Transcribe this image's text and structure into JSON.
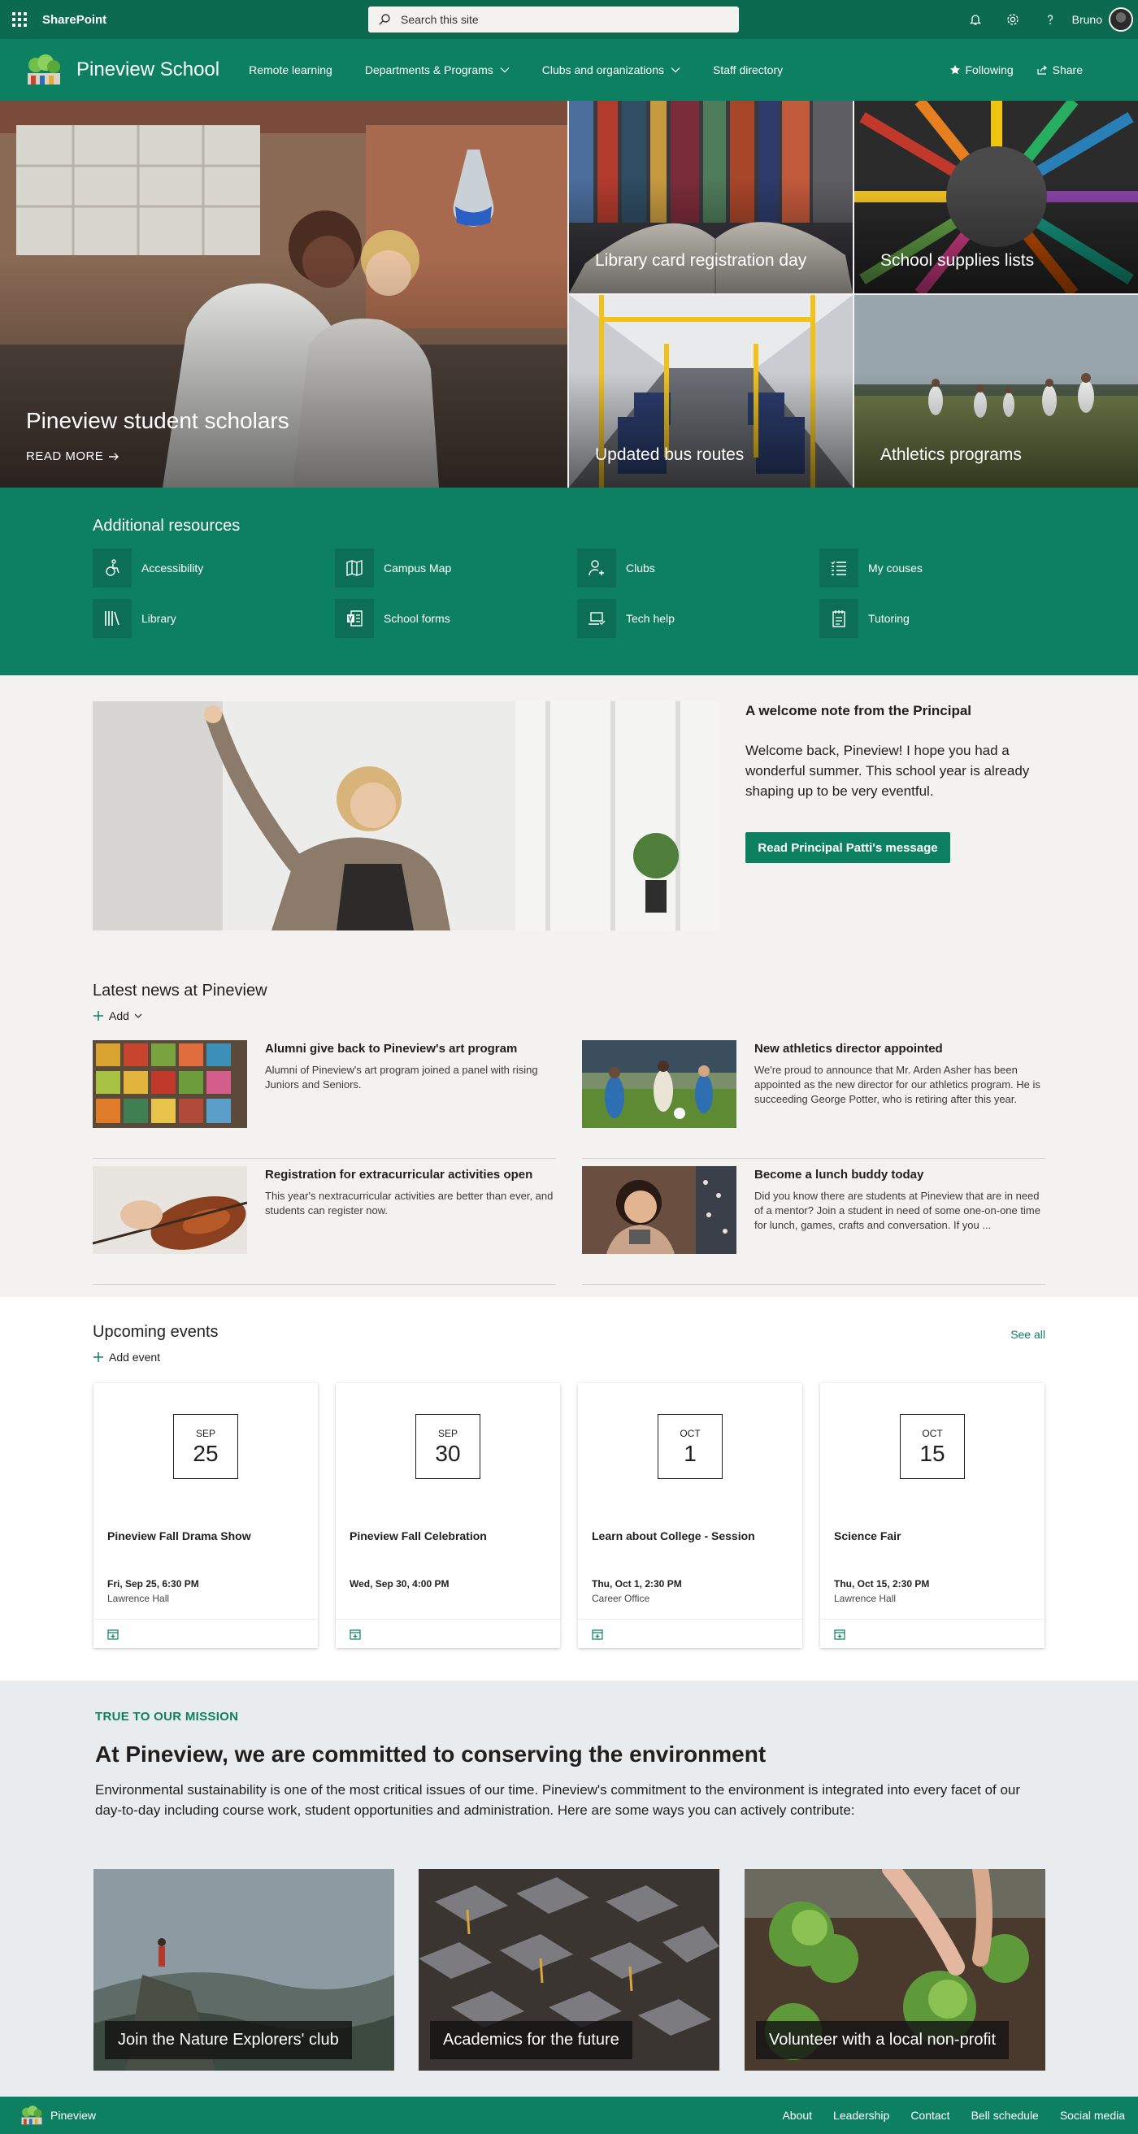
{
  "suite": {
    "app_name": "SharePoint",
    "search_placeholder": "Search this site",
    "user_name": "Bruno"
  },
  "site": {
    "title": "Pineview School",
    "nav": [
      {
        "label": "Remote learning",
        "has_dropdown": false
      },
      {
        "label": "Departments & Programs",
        "has_dropdown": true
      },
      {
        "label": "Clubs and organizations",
        "has_dropdown": true
      },
      {
        "label": "Staff directory",
        "has_dropdown": false
      }
    ],
    "following_label": "Following",
    "share_label": "Share"
  },
  "hero": {
    "main_caption": "Pineview student scholars",
    "read_more": "READ MORE",
    "tiles": [
      "Library card registration day",
      "School supplies lists",
      "Updated bus routes",
      "Athletics programs"
    ]
  },
  "resources": {
    "title": "Additional resources",
    "items": [
      {
        "label": "Accessibility",
        "icon": "accessibility-icon"
      },
      {
        "label": "Campus Map",
        "icon": "map-icon"
      },
      {
        "label": "Clubs",
        "icon": "person-add-icon"
      },
      {
        "label": "My couses",
        "icon": "list-icon"
      },
      {
        "label": "Library",
        "icon": "library-icon"
      },
      {
        "label": "School forms",
        "icon": "forms-icon"
      },
      {
        "label": "Tech help",
        "icon": "laptop-icon"
      },
      {
        "label": "Tutoring",
        "icon": "notepad-icon"
      }
    ]
  },
  "welcome": {
    "title": "A welcome note from the Principal",
    "body": "Welcome back, Pineview! I hope you had a wonderful summer. This school year is already shaping up to be very eventful.",
    "button": "Read Principal Patti's message"
  },
  "news": {
    "title": "Latest news at Pineview",
    "add_label": "Add",
    "items": [
      {
        "title": "Alumni give back to Pineview's art program",
        "summary": "Alumni of Pineview's art program joined a panel with rising Juniors and Seniors."
      },
      {
        "title": "New athletics director appointed",
        "summary": "We're proud to announce that Mr. Arden Asher has been appointed as the new director for our athletics program. He is succeeding George Potter, who is retiring after this year."
      },
      {
        "title": "Registration for extracurricular activities open",
        "summary": "This year's nextracurricular activities are better than ever, and students can register now."
      },
      {
        "title": "Become a lunch buddy today",
        "summary": "Did you know there are students at Pineview that are in need of a mentor? Join a student in need of some one-on-one time for lunch, games, crafts and conversation. If you ..."
      }
    ]
  },
  "events": {
    "title": "Upcoming events",
    "see_all": "See all",
    "add_label": "Add event",
    "items": [
      {
        "month": "SEP",
        "day": "25",
        "title": "Pineview Fall Drama Show",
        "when": "Fri, Sep 25, 6:30 PM",
        "where": "Lawrence Hall"
      },
      {
        "month": "SEP",
        "day": "30",
        "title": "Pineview Fall Celebration",
        "when": "Wed, Sep 30, 4:00 PM",
        "where": ""
      },
      {
        "month": "OCT",
        "day": "1",
        "title": "Learn about College - Session",
        "when": "Thu, Oct 1, 2:30 PM",
        "where": "Career Office"
      },
      {
        "month": "OCT",
        "day": "15",
        "title": "Science Fair",
        "when": "Thu, Oct 15, 2:30 PM",
        "where": "Lawrence Hall"
      }
    ]
  },
  "mission": {
    "kicker": "TRUE TO OUR MISSION",
    "title": "At Pineview, we are committed to conserving the environment",
    "body": "Environmental sustainability is one of the most critical issues of our time. Pineview's commitment to the environment is integrated into every facet of our day-to-day including course work, student opportunities and administration. Here are some ways you can actively contribute:",
    "cards": [
      "Join the Nature Explorers' club",
      "Academics for the future",
      "Volunteer with a local non-profit"
    ]
  },
  "footer": {
    "name": "Pineview",
    "links": [
      "About",
      "Leadership",
      "Contact",
      "Bell schedule",
      "Social media"
    ]
  },
  "colors": {
    "suite_bar": "#0b6a4f",
    "brand": "#0e8062",
    "page_bg": "#f3f2f1"
  }
}
